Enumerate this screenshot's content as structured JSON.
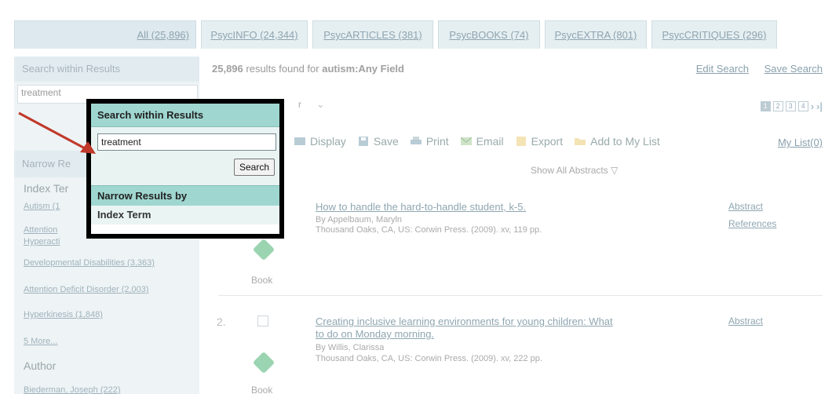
{
  "tabs": [
    {
      "label": "All (25,896)",
      "active": true
    },
    {
      "label": "PsycINFO (24,344)"
    },
    {
      "label": "PsycARTICLES (381)"
    },
    {
      "label": "PsycBOOKS (74)"
    },
    {
      "label": "PsycEXTRA (801)"
    },
    {
      "label": "PsycCRITIQUES (296)"
    }
  ],
  "sidebar": {
    "search_heading": "Search within Results",
    "search_value": "treatment",
    "narrow_heading": "Narrow Re",
    "index_term_heading": "Index Ter",
    "index_terms": [
      "Autism (1",
      "Attention",
      "Hyperacti",
      "Developmental Disabilities (3,363)",
      "Attention Deficit Disorder (2,003)",
      "Hyperkinesis (1,848)",
      "5 More..."
    ],
    "author_heading": "Author",
    "authors": [
      "Biederman, Joseph (222)"
    ]
  },
  "main": {
    "count_number": "25,896",
    "count_text": "results found for",
    "query": "autism:Any Field",
    "edit_search": "Edit Search",
    "save_search": "Save Search",
    "sort_value": "r",
    "pages": [
      "1",
      "2",
      "3",
      "4"
    ],
    "next_arrow": "›",
    "last_arrow": "›|",
    "toolbar": {
      "display": "Display",
      "save": "Save",
      "print": "Print",
      "email": "Email",
      "export": "Export",
      "add_to_list": "Add to My List"
    },
    "my_list": "My List(0)",
    "show_all_abstracts": "Show All Abstracts",
    "results": [
      {
        "number": "",
        "title_line1": "How to handle the hard-to-handle student, k-5.",
        "title_line2": "",
        "by": "By Appelbaum, Maryln",
        "publisher": "Thousand Oaks, CA, US: Corwin Press. (2009). xv, 119 pp.",
        "type": "Book",
        "links": [
          "Abstract",
          "References"
        ]
      },
      {
        "number": "2.",
        "title_line1": "Creating inclusive learning environments for young children: What",
        "title_line2": "to do on Monday morning.",
        "by": "By Willis, Clarissa",
        "publisher": "Thousand Oaks, CA, US: Corwin Press. (2009). xv, 222 pp.",
        "type": "Book",
        "links": [
          "Abstract"
        ]
      }
    ]
  },
  "callout": {
    "heading": "Search within Results",
    "input_value": "treatment",
    "button": "Search",
    "narrow_heading": "Narrow Results by",
    "index_term": "Index Term"
  },
  "colors": {
    "callout_header": "#9fd6d0",
    "arrow": "#c0392b",
    "link": "#8aa1ad"
  }
}
